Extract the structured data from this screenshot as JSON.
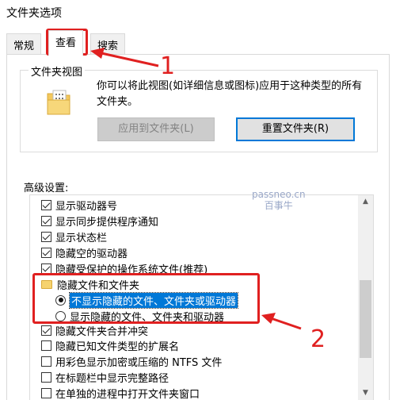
{
  "window": {
    "title": "文件夹选项"
  },
  "tabs": [
    {
      "label": "常规"
    },
    {
      "label": "查看"
    },
    {
      "label": "搜索"
    }
  ],
  "folder_views": {
    "group_label": "文件夹视图",
    "description": "你可以将此视图(如详细信息或图标)应用于这种类型的所有文件夹。",
    "apply_button": "应用到文件夹(L)",
    "reset_button": "重置文件夹(R)"
  },
  "advanced": {
    "label": "高级设置:",
    "items": [
      {
        "label": "显示驱动器号",
        "type": "checkbox",
        "checked": true
      },
      {
        "label": "显示同步提供程序通知",
        "type": "checkbox",
        "checked": true
      },
      {
        "label": "显示状态栏",
        "type": "checkbox",
        "checked": true
      },
      {
        "label": "隐藏空的驱动器",
        "type": "checkbox",
        "checked": true
      },
      {
        "label": "隐藏受保护的操作系统文件(推荐)",
        "type": "checkbox",
        "checked": true
      },
      {
        "label": "隐藏文件和文件夹",
        "type": "folder"
      },
      {
        "label": "不显示隐藏的文件、文件夹或驱动器",
        "type": "radio",
        "checked": true,
        "selected": true
      },
      {
        "label": "显示隐藏的文件、文件夹和驱动器",
        "type": "radio",
        "checked": false
      },
      {
        "label": "隐藏文件夹合并冲突",
        "type": "checkbox",
        "checked": true
      },
      {
        "label": "隐藏已知文件类型的扩展名",
        "type": "checkbox",
        "checked": false
      },
      {
        "label": "用彩色显示加密或压缩的 NTFS 文件",
        "type": "checkbox",
        "checked": false
      },
      {
        "label": "在标题栏中显示完整路径",
        "type": "checkbox",
        "checked": false
      },
      {
        "label": "在单独的进程中打开文件夹窗口",
        "type": "checkbox",
        "checked": false
      }
    ]
  },
  "annotations": {
    "step1": "1",
    "step2": "2",
    "color": "#e02020"
  },
  "watermark": {
    "line1": "passneo.cn",
    "line2": "百事牛"
  },
  "colors": {
    "selection": "#0078d7",
    "focus_border": "#0078d7"
  }
}
